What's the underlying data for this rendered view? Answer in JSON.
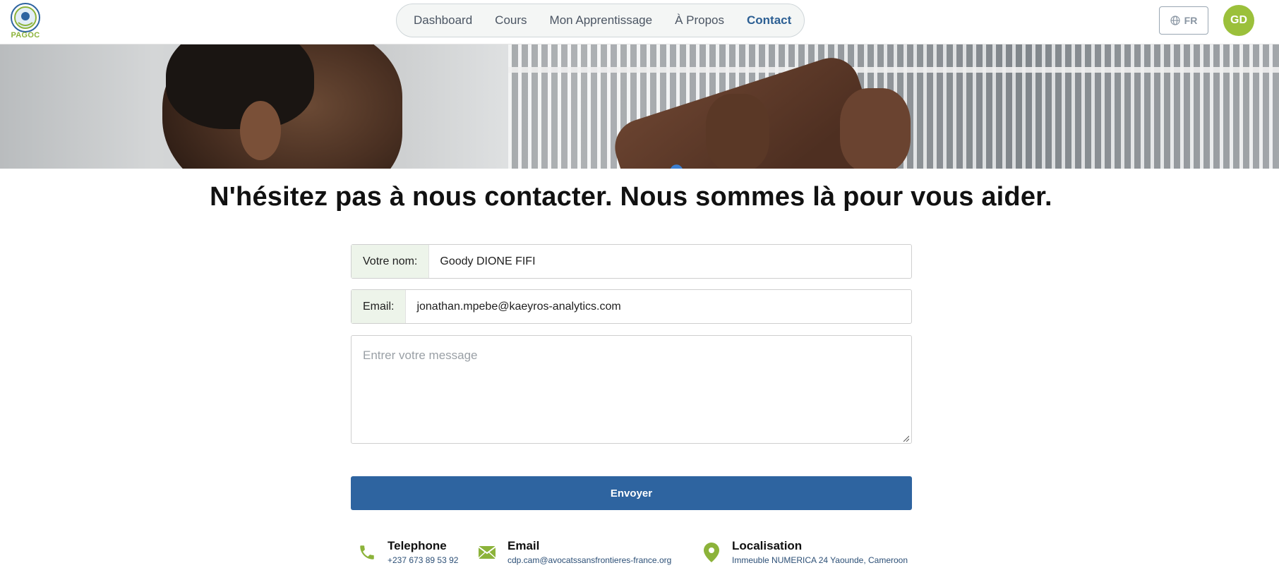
{
  "brand": {
    "logo_text": "PAGOC",
    "accent": "#9bc03b",
    "primary": "#2e64a0"
  },
  "nav": {
    "items": [
      {
        "label": "Dashboard",
        "active": false
      },
      {
        "label": "Cours",
        "active": false
      },
      {
        "label": "Mon Apprentissage",
        "active": false
      },
      {
        "label": "À Propos",
        "active": false
      },
      {
        "label": "Contact",
        "active": true
      }
    ]
  },
  "header": {
    "language": "FR",
    "avatar_initials": "GD"
  },
  "page": {
    "headline": "N'hésitez pas à nous contacter. Nous sommes là pour vous aider."
  },
  "form": {
    "name_label": "Votre nom:",
    "name_value": "Goody DIONE FIFI",
    "email_label": "Email:",
    "email_value": "jonathan.mpebe@kaeyros-analytics.com",
    "message_placeholder": "Entrer votre message",
    "submit_label": "Envoyer"
  },
  "contact_info": {
    "phone": {
      "title": "Telephone",
      "value": "+237 673 89 53 92",
      "icon": "phone-icon"
    },
    "email": {
      "title": "Email",
      "value": "cdp.cam@avocatssansfrontieres-france.org",
      "icon": "envelope-icon"
    },
    "location": {
      "title": "Localisation",
      "value": "Immeuble NUMERICA 24 Yaounde, Cameroon",
      "icon": "map-pin-icon"
    }
  }
}
